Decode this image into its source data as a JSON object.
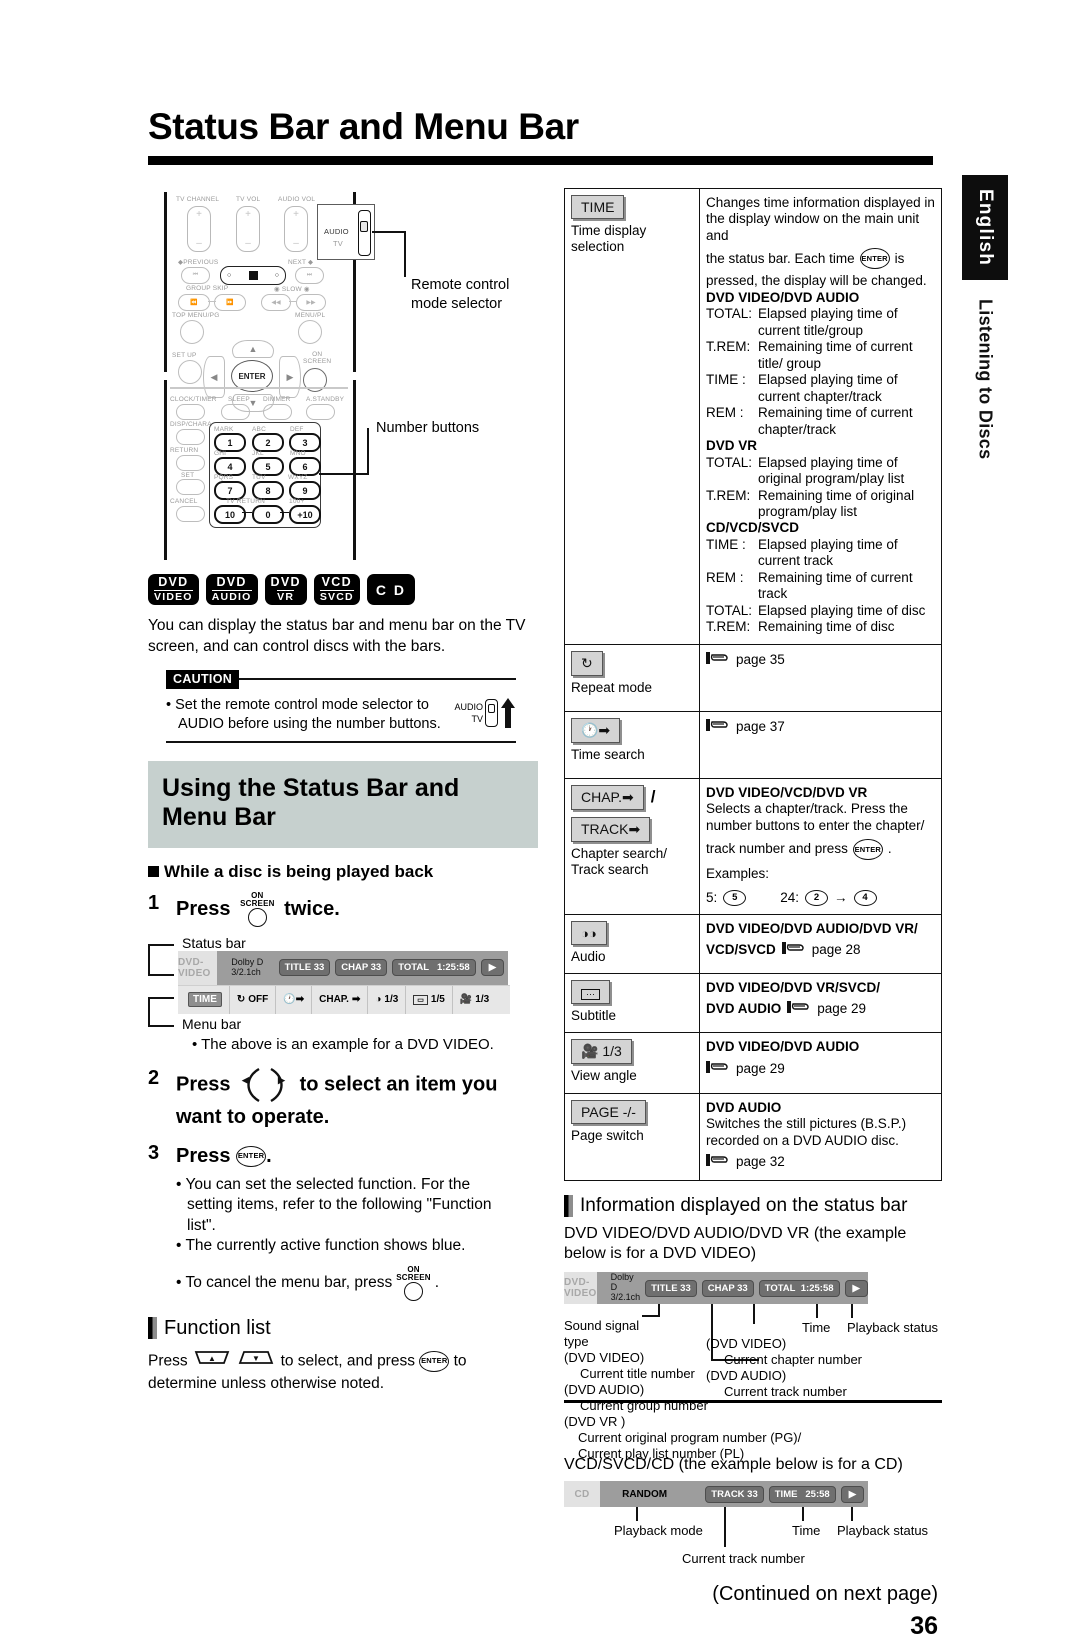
{
  "page": {
    "title": "Status Bar and Menu Bar",
    "number": "36",
    "continued": "(Continued on next page)"
  },
  "side_tabs": {
    "language": "English",
    "section": "Listening to Discs"
  },
  "remote_figure": {
    "callouts": [
      "Remote control\nmode selector",
      "Number buttons"
    ],
    "callout_mode_selector_line1": "Remote control",
    "callout_mode_selector_line2": "mode selector",
    "callout_number_buttons": "Number buttons",
    "labels": {
      "tv_channel": "TV CHANNEL",
      "tv_vol": "TV VOL",
      "audio_vol": "AUDIO VOL",
      "previous": "PREVIOUS",
      "next": "NEXT",
      "group_skip": "GROUP SKIP",
      "slow": "SLOW",
      "top_menu_pg": "TOP MENU/PG",
      "menu_pl": "MENU/PL",
      "set_up": "SET UP",
      "on_screen": "ON SCREEN",
      "clock_timer": "CLOCK/TIMER",
      "sleep": "SLEEP",
      "dimmer": "DIMMER",
      "a_standby": "A.STANDBY",
      "disp_chara": "DISP/CHARA",
      "return": "RETURN",
      "set": "SET",
      "cancel": "CANCEL",
      "tv_return": "TV RETURN",
      "audio": "AUDIO",
      "tv": "TV",
      "enter": "ENTER",
      "mark": "MARK",
      "abc": "ABC",
      "def": "DEF",
      "ghi": "GHI",
      "jkl": "JKL",
      "mno": "MNO",
      "pqrs": "PQRS",
      "tuv": "TUV",
      "wxyz": "WXYZ",
      "hundred_plus": "100+"
    },
    "number_keys": [
      "1",
      "2",
      "3",
      "4",
      "5",
      "6",
      "7",
      "8",
      "9",
      "10",
      "0",
      "+10"
    ]
  },
  "disc_badges": [
    {
      "line1": "DVD",
      "line2": "VIDEO"
    },
    {
      "line1": "DVD",
      "line2": "AUDIO"
    },
    {
      "line1": "DVD",
      "line2": "VR"
    },
    {
      "line1": "VCD",
      "line2": "SVCD"
    },
    {
      "line1": "C D",
      "line2": ""
    }
  ],
  "intro_text": "You can display the status bar and menu bar on the TV screen, and can control discs with the bars.",
  "caution": {
    "label": "CAUTION",
    "bullet": "• Set the remote control mode selector to AUDIO before using the number buttons.",
    "bullet_line1": "• Set the remote control mode selector to",
    "bullet_line2": "AUDIO before using the number buttons.",
    "selector_top": "AUDIO",
    "selector_bottom": "TV"
  },
  "using_section": {
    "heading_line1": "Using the Status Bar and",
    "heading_line2": "Menu Bar",
    "subheading": "While a disc is being played back",
    "steps": [
      {
        "number": "1",
        "text_before": "Press",
        "button": "ON SCREEN",
        "text_after": "twice."
      },
      {
        "number": "2",
        "text_before": "Press",
        "button": "left-right-cursor",
        "text_after": "to select an item you want to operate."
      },
      {
        "number": "3",
        "text_before": "Press",
        "button": "ENTER",
        "text_after": "."
      }
    ],
    "step3_bullets": [
      "• You can set the selected function. For the setting items, refer to the following \"Function list\".",
      "• The currently active function shows blue.",
      "• To cancel the menu bar, press"
    ],
    "bullet1_l1": "• You can set the selected function. For the",
    "bullet1_l2": "setting items, refer to the following \"Function",
    "bullet1_l3": "list\".",
    "bullet2": "• The currently active function shows blue.",
    "bullet3": "• To cancel the menu bar, press",
    "bullet3_btn": "ON SCREEN",
    "figure": {
      "status_bar_label": "Status bar",
      "menu_bar_label": "Menu bar",
      "note": "• The above is an example for a DVD VIDEO.",
      "status_bar": {
        "disc": "DVD-VIDEO",
        "sound_line1": "Dolby D",
        "sound_line2": "3/2.1ch",
        "title": "TITLE 33",
        "chapter": "CHAP 33",
        "time_label": "TOTAL",
        "time_value": "1:25:58",
        "playback": "▶"
      },
      "menu_bar": [
        {
          "icon": "time-icon",
          "label": "TIME"
        },
        {
          "icon": "repeat-icon",
          "label": "OFF"
        },
        {
          "icon": "time-search-icon",
          "label": ""
        },
        {
          "icon": "chapter-icon",
          "label": "CHAP."
        },
        {
          "icon": "audio-icon",
          "label": "1/3"
        },
        {
          "icon": "subtitle-icon",
          "label": "1/5"
        },
        {
          "icon": "angle-icon",
          "label": "1/3"
        }
      ]
    }
  },
  "function_list": {
    "heading": "Function list",
    "intro_before": "Press",
    "intro_middle": "to select, and press",
    "intro_after": "to determine unless otherwise noted.",
    "intro_l1_a": "Press",
    "intro_l1_b": "to select, and press",
    "intro_l1_c": "to",
    "intro_l2": "determine unless otherwise noted."
  },
  "table": {
    "rows": [
      {
        "chip": "TIME",
        "chip_type": "text",
        "chip_label_l1": "Time display",
        "chip_label_l2": "selection",
        "desc_blocks": [
          {
            "type": "para",
            "text": "Changes time information displayed in the display window on the main unit and"
          },
          {
            "type": "para_enter",
            "before": "the status bar. Each time",
            "after": "is"
          },
          {
            "type": "para",
            "text": "pressed, the display will be changed."
          },
          {
            "type": "bold",
            "text": "DVD VIDEO/DVD AUDIO"
          },
          {
            "type": "kv",
            "k": "TOTAL:",
            "v": "Elapsed playing time of current title/group"
          },
          {
            "type": "kv",
            "k": "T.REM:",
            "v": "Remaining time of current title/ group"
          },
          {
            "type": "kv",
            "k": "TIME  :",
            "v": "Elapsed playing time of current chapter/track"
          },
          {
            "type": "kv",
            "k": "REM   :",
            "v": "Remaining time of current chapter/track"
          },
          {
            "type": "bold",
            "text": "DVD VR"
          },
          {
            "type": "kv",
            "k": "TOTAL:",
            "v": "Elapsed playing time of original program/play list"
          },
          {
            "type": "kv",
            "k": "T.REM:",
            "v": "Remaining time of original program/play list"
          },
          {
            "type": "bold",
            "text": "CD/VCD/SVCD"
          },
          {
            "type": "kv",
            "k": "TIME  :",
            "v": "Elapsed playing time of current track"
          },
          {
            "type": "kv",
            "k": "REM   :",
            "v": "Remaining time of current track"
          },
          {
            "type": "kv",
            "k": "TOTAL:",
            "v": "Elapsed playing time of disc"
          },
          {
            "type": "kv",
            "k": "T.REM:",
            "v": "Remaining time of disc"
          }
        ]
      },
      {
        "chip": "repeat-icon",
        "chip_type": "icon",
        "chip_label_l1": "Repeat mode",
        "chip_label_l2": "",
        "desc_blocks": [
          {
            "type": "page",
            "text": "page 35"
          }
        ]
      },
      {
        "chip": "time-search-icon",
        "chip_type": "icon",
        "chip_label_l1": "Time search",
        "chip_label_l2": "",
        "desc_blocks": [
          {
            "type": "page",
            "text": "page 37"
          }
        ]
      },
      {
        "chip": "CHAP./TRACK",
        "chip_type": "dual",
        "chip_a": "CHAP.",
        "chip_b": "TRACK",
        "chip_sep": "/",
        "chip_label_l1": "Chapter search/",
        "chip_label_l2": "Track search",
        "desc_blocks": [
          {
            "type": "bold",
            "text": "DVD VIDEO/VCD/DVD VR"
          },
          {
            "type": "para",
            "text": "Selects a chapter/track. Press the number buttons to enter the chapter/"
          },
          {
            "type": "para_enter",
            "before": "track number and press",
            "after": "."
          },
          {
            "type": "para",
            "text": "Examples:"
          },
          {
            "type": "examples",
            "ex1_label": "5:",
            "ex1_keys": [
              "5"
            ],
            "ex2_label": "24:",
            "ex2_keys": [
              "2",
              "4"
            ]
          }
        ]
      },
      {
        "chip": "audio-icon",
        "chip_type": "icon",
        "chip_label_l1": "Audio",
        "chip_label_l2": "",
        "desc_blocks": [
          {
            "type": "bold",
            "text": "DVD VIDEO/DVD AUDIO/DVD VR/"
          },
          {
            "type": "bold_page",
            "bold": "VCD/SVCD",
            "page": "page 28"
          }
        ]
      },
      {
        "chip": "subtitle-icon",
        "chip_type": "icon",
        "chip_label_l1": "Subtitle",
        "chip_label_l2": "",
        "desc_blocks": [
          {
            "type": "bold",
            "text": "DVD VIDEO/DVD VR/SVCD/"
          },
          {
            "type": "bold_page",
            "bold": "DVD AUDIO",
            "page": "page 29"
          }
        ]
      },
      {
        "chip": "angle-icon",
        "chip_type": "icon_num",
        "chip_num": "1/3",
        "chip_label_l1": "View angle",
        "chip_label_l2": "",
        "desc_blocks": [
          {
            "type": "bold",
            "text": "DVD VIDEO/DVD AUDIO"
          },
          {
            "type": "page",
            "text": "page 29"
          }
        ]
      },
      {
        "chip": "PAGE  -/-",
        "chip_type": "text",
        "chip_label_l1": "Page switch",
        "chip_label_l2": "",
        "desc_blocks": [
          {
            "type": "bold",
            "text": "DVD AUDIO"
          },
          {
            "type": "para",
            "text": "Switches the still pictures (B.S.P.) recorded on a DVD AUDIO disc."
          },
          {
            "type": "page",
            "text": "page 32"
          }
        ]
      }
    ]
  },
  "info_section": {
    "heading": "Information displayed on the status bar",
    "dvd": {
      "caption_l1": "DVD VIDEO/DVD AUDIO/DVD VR (the example",
      "caption_l2": "below is for a DVD VIDEO)",
      "bar": {
        "disc": "DVD-VIDEO",
        "sound_line1": "Dolby D",
        "sound_line2": "3/2.1ch",
        "title": "TITLE 33",
        "chapter": "CHAP 33",
        "time_label": "TOTAL",
        "time_value": "1:25:58",
        "playback": "▶"
      },
      "annotations": {
        "sound_l1": "Sound signal",
        "sound_l2": "type",
        "time": "Time",
        "playback": "Playback status",
        "title_group_l1": "(DVD VIDEO)",
        "title_group_l2": "Current title number",
        "title_group_l3": "(DVD AUDIO)",
        "title_group_l4": "Current group number",
        "title_group_l5": "(DVD VR )",
        "title_group_l6": "Current original program number (PG)/",
        "title_group_l7": "Current play list number (PL)",
        "chapter_l1": "(DVD VIDEO)",
        "chapter_l2": "Current chapter number",
        "chapter_l3": "(DVD AUDIO)",
        "chapter_l4": "Current track number"
      }
    },
    "cd": {
      "caption": "VCD/SVCD/CD (the example below is for a CD)",
      "bar": {
        "disc": "CD",
        "mode": "RANDOM",
        "track": "TRACK 33",
        "time_label": "TIME",
        "time_value": "25:58",
        "playback": "▶"
      },
      "annotations": {
        "playback_mode": "Playback mode",
        "track": "Current track number",
        "time": "Time",
        "status": "Playback status"
      }
    }
  },
  "colors": {
    "heading_bg": "#c6d0ce",
    "tab_black": "#0d0d0d",
    "osd_status_bg": "#9d9d9d",
    "osd_menu_bg": "#e7e7e7",
    "chip_bg": "#d4d4d4"
  }
}
